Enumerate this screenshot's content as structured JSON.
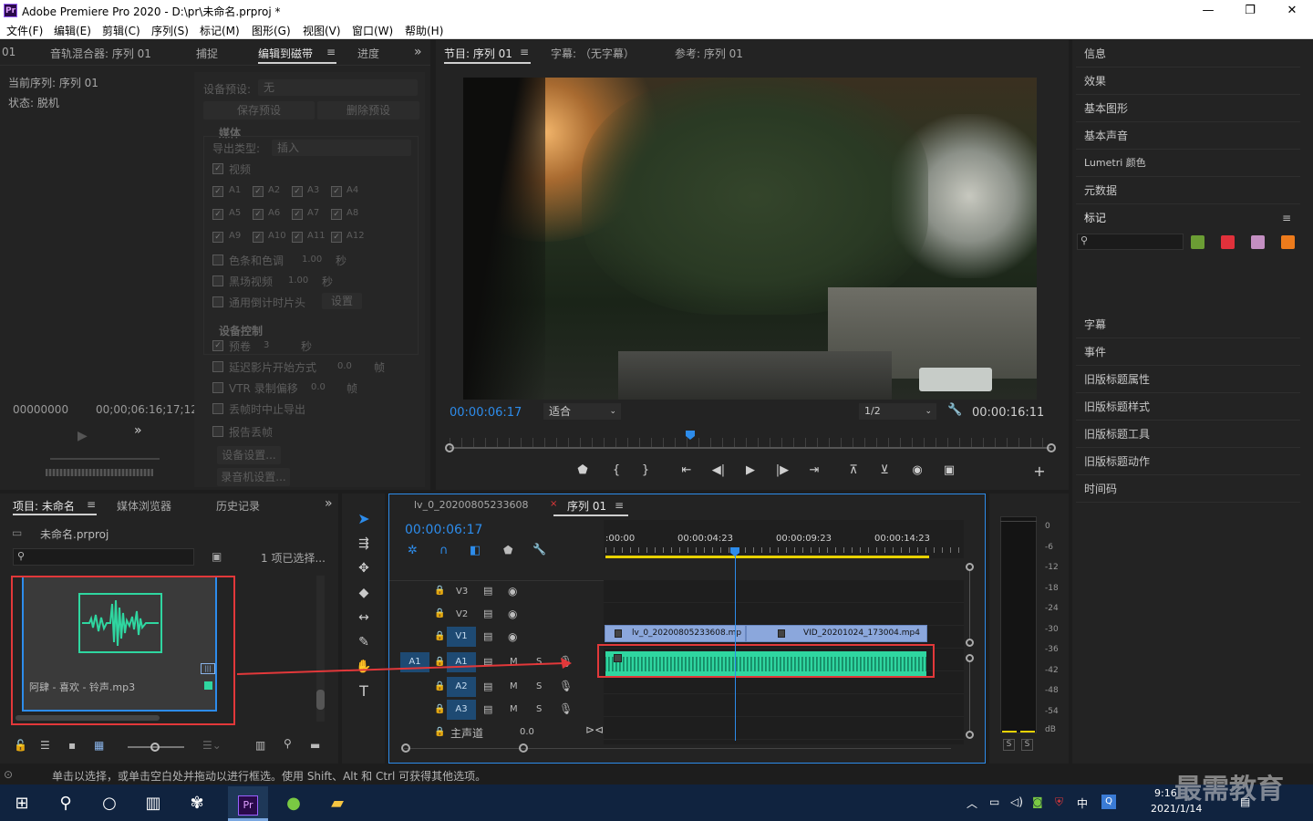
{
  "window": {
    "title": "Adobe Premiere Pro 2020 - D:\\pr\\未命名.prproj *",
    "app_icon": "Pr"
  },
  "menu": [
    "文件(F)",
    "编辑(E)",
    "剪辑(C)",
    "序列(S)",
    "标记(M)",
    "图形(G)",
    "视图(V)",
    "窗口(W)",
    "帮助(H)"
  ],
  "left_panel": {
    "tabs": [
      "01",
      "音轨混合器: 序列 01",
      "捕捉",
      "编辑到磁带",
      "进度"
    ],
    "current_sequence": "当前序列: 序列 01",
    "status": "状态: 脱机",
    "timecodes": [
      "00;00;00;00",
      "00;00;16;12"
    ],
    "timecodes_garbled": [
      "00000000",
      "00;00;06:16;17;12"
    ]
  },
  "export_panel": {
    "device_preset_label": "设备预设:",
    "device_preset_value": "无",
    "save_preset": "保存预设",
    "delete_preset": "删除预设",
    "media_header": "媒体",
    "export_type_label": "导出类型:",
    "export_type_value": "插入",
    "video": "视频",
    "audio_tracks": [
      "A1",
      "A2",
      "A3",
      "A4",
      "A5",
      "A6",
      "A7",
      "A8",
      "A9",
      "A10",
      "A11",
      "A12"
    ],
    "bars_tones": "色条和色调",
    "bars_val": "1.00",
    "sec": "秒",
    "black_video": "黑场视频",
    "black_val": "1.00",
    "countdown": "通用倒计时片头",
    "settings_btn": "设置",
    "device_control": "设备控制",
    "preroll": "预卷",
    "preroll_val": "3",
    "delay_start": "延迟影片开始方式",
    "delay_val": "0.0",
    "frames": "帧",
    "vtr_offset": "VTR 录制偏移",
    "vtr_val": "0.0",
    "abort_dropped": "丢帧时中止导出",
    "report_dropped": "报告丢帧",
    "device_settings": "设备设置...",
    "recorder_settings": "录音机设置..."
  },
  "program_monitor": {
    "tabs": [
      "节目: 序列 01",
      "字幕: （无字幕）",
      "参考: 序列 01"
    ],
    "timecode_current": "00:00:06:17",
    "fit": "适合",
    "resolution": "1/2",
    "timecode_duration": "00:00:16:11",
    "playhead_position": 0.4
  },
  "right_panel": {
    "items_top": [
      "信息",
      "效果",
      "基本图形",
      "基本声音",
      "Lumetri 颜色",
      "元数据"
    ],
    "markers_label": "标记",
    "marker_colors": [
      "#6b9d34",
      "#e0313b",
      "#c48fc2",
      "#ed7b1c"
    ],
    "items_bottom": [
      "字幕",
      "事件",
      "旧版标题属性",
      "旧版标题样式",
      "旧版标题工具",
      "旧版标题动作",
      "时间码"
    ]
  },
  "project_panel": {
    "tabs": [
      "项目: 未命名",
      "媒体浏览器",
      "历史记录"
    ],
    "project_file": "未命名.prproj",
    "selection": "1 项已选择...",
    "clip_name": "阿肆 - 喜欢 - 铃声.mp3"
  },
  "timeline": {
    "tabs": [
      "lv_0_20200805233608",
      "序列 01"
    ],
    "timecode": "00:00:06:17",
    "ruler_labels": [
      ":00:00",
      "00:00:04:23",
      "00:00:09:23",
      "00:00:14:23"
    ],
    "playhead_fraction": 0.4,
    "video_tracks": [
      "V3",
      "V2",
      "V1"
    ],
    "audio_tracks": [
      "A1",
      "A2",
      "A3"
    ],
    "source_patch": "A1",
    "master_label": "主声道",
    "master_value": "0.0",
    "clip1": "lv_0_20200805233608.mp",
    "clip2": "VID_20201024_173004.mp4",
    "mute": "M",
    "solo": "S"
  },
  "vu_meter": {
    "labels": [
      "0",
      "-6",
      "-12",
      "-18",
      "-24",
      "-30",
      "-36",
      "-42",
      "-48",
      "-54",
      "dB"
    ],
    "solo_buttons": [
      "S",
      "S"
    ]
  },
  "status_bar": "单击以选择，或单击空白处并拖动以进行框选。使用 Shift、Alt 和 Ctrl 可获得其他选项。",
  "taskbar": {
    "time": "9:16",
    "date": "2021/1/14",
    "ime": "中",
    "watermark": "最需教育"
  },
  "colors": {
    "accent": "#2d8ceb",
    "audio_clip": "#2fd6a0",
    "video_clip": "#8ba7dc",
    "highlight_box": "#e2383a"
  }
}
